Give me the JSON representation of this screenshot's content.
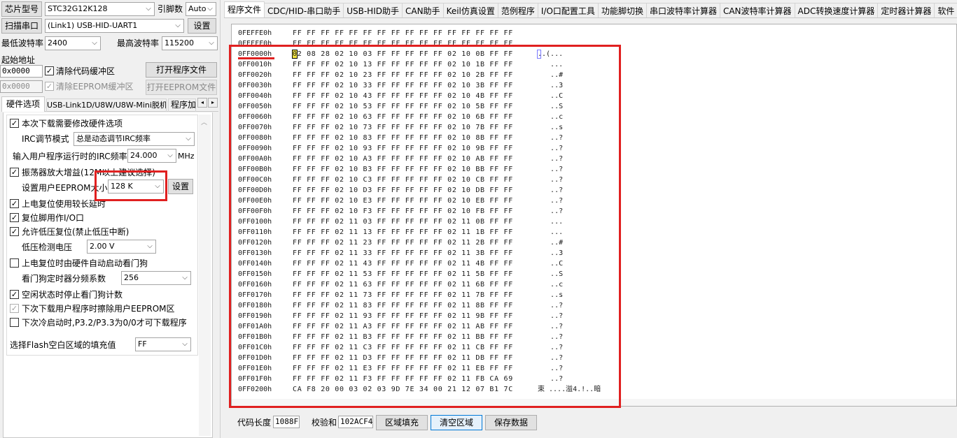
{
  "left": {
    "chip_label": "芯片型号",
    "chip_value": "STC32G12K128",
    "pins_label": "引脚数",
    "pins_value": "Auto",
    "scan_button": "扫描串口",
    "port_value": "(Link1) USB-HID-UART1",
    "settings_button": "设置",
    "min_baud_label": "最低波特率",
    "min_baud_value": "2400",
    "max_baud_label": "最高波特率",
    "max_baud_value": "115200",
    "start_addr_label": "起始地址",
    "code_addr_value": "0x0000",
    "clear_code_label": "清除代码缓冲区",
    "open_program_button": "打开程序文件",
    "eeprom_addr_value": "0x0000",
    "clear_eeprom_label": "清除EEPROM缓冲区",
    "open_eeprom_button": "打开EEPROM文件",
    "subtabs": [
      "硬件选项",
      "USB-Link1D/U8W/U8W-Mini脱机",
      "程序加"
    ],
    "options": {
      "opt1": "本次下载需要修改硬件选项",
      "irc_mode_label": "IRC调节模式",
      "irc_mode_value": "总是动态调节IRC频率",
      "irc_freq_label": "输入用户程序运行时的IRC频率",
      "irc_freq_value": "24.000",
      "irc_freq_unit": "MHz",
      "osc_gain_label": "振荡器放大增益(12M以上建议选择)",
      "eeprom_size_label": "设置用户EEPROM大小",
      "eeprom_size_value": "128  K",
      "eeprom_set_button": "设置",
      "long_delay_label": "上电复位使用较长延时",
      "reset_pin_label": "复位脚用作I/O口",
      "lvr_label": "允许低压复位(禁止低压中断)",
      "lv_detect_label": "低压检测电压",
      "lv_detect_value": "2.00 V",
      "wdt_label": "上电复位时由硬件自动启动看门狗",
      "wdt_div_label": "看门狗定时器分频系数",
      "wdt_div_value": "256",
      "idle_wdt_label": "空闲状态时停止看门狗计数",
      "erase_eeprom_label": "下次下载用户程序时擦除用户EEPROM区",
      "cold_boot_label": "下次冷启动时,P3.2/P3.3为0/0才可下载程序",
      "fill_label": "选择Flash空白区域的填充值",
      "fill_value": "FF"
    }
  },
  "tabs": [
    "程序文件",
    "CDC/HID-串口助手",
    "USB-HID助手",
    "CAN助手",
    "Keil仿真设置",
    "范例程序",
    "I/O口配置工具",
    "功能脚切换",
    "串口波特率计算器",
    "CAN波特率计算器",
    "ADC转换速度计算器",
    "定时器计算器",
    "软件"
  ],
  "hex_rows": [
    {
      "addr": "0FEFFE0h",
      "bytes": "FF FF FF FF FF FF FF FF FF FF FF FF FF FF FF FF",
      "ascii": ""
    },
    {
      "addr": "0FEFFF0h",
      "bytes": "FF FF FF FF FF FF FF FF FF FF FF FF FF FF FF FF",
      "ascii": ""
    },
    {
      "addr": "0FF0000h",
      "bytes": "02 08 28 02 10 03 FF FF FF FF FF 02 10 0B FF FF",
      "ascii": "..(..."
    },
    {
      "addr": "0FF0010h",
      "bytes": "FF FF FF 02 10 13 FF FF FF FF FF 02 10 1B FF FF",
      "ascii": "   ..."
    },
    {
      "addr": "0FF0020h",
      "bytes": "FF FF FF 02 10 23 FF FF FF FF FF 02 10 2B FF FF",
      "ascii": "   ..#"
    },
    {
      "addr": "0FF0030h",
      "bytes": "FF FF FF 02 10 33 FF FF FF FF FF 02 10 3B FF FF",
      "ascii": "   ..3"
    },
    {
      "addr": "0FF0040h",
      "bytes": "FF FF FF 02 10 43 FF FF FF FF FF 02 10 4B FF FF",
      "ascii": "   ..C"
    },
    {
      "addr": "0FF0050h",
      "bytes": "FF FF FF 02 10 53 FF FF FF FF FF 02 10 5B FF FF",
      "ascii": "   ..S"
    },
    {
      "addr": "0FF0060h",
      "bytes": "FF FF FF 02 10 63 FF FF FF FF FF 02 10 6B FF FF",
      "ascii": "   ..c"
    },
    {
      "addr": "0FF0070h",
      "bytes": "FF FF FF 02 10 73 FF FF FF FF FF 02 10 7B FF FF",
      "ascii": "   ..s"
    },
    {
      "addr": "0FF0080h",
      "bytes": "FF FF FF 02 10 83 FF FF FF FF FF 02 10 8B FF FF",
      "ascii": "   ..?"
    },
    {
      "addr": "0FF0090h",
      "bytes": "FF FF FF 02 10 93 FF FF FF FF FF 02 10 9B FF FF",
      "ascii": "   ..?"
    },
    {
      "addr": "0FF00A0h",
      "bytes": "FF FF FF 02 10 A3 FF FF FF FF FF 02 10 AB FF FF",
      "ascii": "   ..?"
    },
    {
      "addr": "0FF00B0h",
      "bytes": "FF FF FF 02 10 B3 FF FF FF FF FF 02 10 BB FF FF",
      "ascii": "   ..?"
    },
    {
      "addr": "0FF00C0h",
      "bytes": "FF FF FF 02 10 C3 FF FF FF FF FF 02 10 CB FF FF",
      "ascii": "   ..?"
    },
    {
      "addr": "0FF00D0h",
      "bytes": "FF FF FF 02 10 D3 FF FF FF FF FF 02 10 DB FF FF",
      "ascii": "   ..?"
    },
    {
      "addr": "0FF00E0h",
      "bytes": "FF FF FF 02 10 E3 FF FF FF FF FF 02 10 EB FF FF",
      "ascii": "   ..?"
    },
    {
      "addr": "0FF00F0h",
      "bytes": "FF FF FF 02 10 F3 FF FF FF FF FF 02 10 FB FF FF",
      "ascii": "   ..?"
    },
    {
      "addr": "0FF0100h",
      "bytes": "FF FF FF 02 11 03 FF FF FF FF FF 02 11 0B FF FF",
      "ascii": "   ..."
    },
    {
      "addr": "0FF0110h",
      "bytes": "FF FF FF 02 11 13 FF FF FF FF FF 02 11 1B FF FF",
      "ascii": "   ..."
    },
    {
      "addr": "0FF0120h",
      "bytes": "FF FF FF 02 11 23 FF FF FF FF FF 02 11 2B FF FF",
      "ascii": "   ..#"
    },
    {
      "addr": "0FF0130h",
      "bytes": "FF FF FF 02 11 33 FF FF FF FF FF 02 11 3B FF FF",
      "ascii": "   ..3"
    },
    {
      "addr": "0FF0140h",
      "bytes": "FF FF FF 02 11 43 FF FF FF FF FF 02 11 4B FF FF",
      "ascii": "   ..C"
    },
    {
      "addr": "0FF0150h",
      "bytes": "FF FF FF 02 11 53 FF FF FF FF FF 02 11 5B FF FF",
      "ascii": "   ..S"
    },
    {
      "addr": "0FF0160h",
      "bytes": "FF FF FF 02 11 63 FF FF FF FF FF 02 11 6B FF FF",
      "ascii": "   ..c"
    },
    {
      "addr": "0FF0170h",
      "bytes": "FF FF FF 02 11 73 FF FF FF FF FF 02 11 7B FF FF",
      "ascii": "   ..s"
    },
    {
      "addr": "0FF0180h",
      "bytes": "FF FF FF 02 11 83 FF FF FF FF FF 02 11 8B FF FF",
      "ascii": "   ..?"
    },
    {
      "addr": "0FF0190h",
      "bytes": "FF FF FF 02 11 93 FF FF FF FF FF 02 11 9B FF FF",
      "ascii": "   ..?"
    },
    {
      "addr": "0FF01A0h",
      "bytes": "FF FF FF 02 11 A3 FF FF FF FF FF 02 11 AB FF FF",
      "ascii": "   ..?"
    },
    {
      "addr": "0FF01B0h",
      "bytes": "FF FF FF 02 11 B3 FF FF FF FF FF 02 11 BB FF FF",
      "ascii": "   ..?"
    },
    {
      "addr": "0FF01C0h",
      "bytes": "FF FF FF 02 11 C3 FF FF FF FF FF 02 11 CB FF FF",
      "ascii": "   ..?"
    },
    {
      "addr": "0FF01D0h",
      "bytes": "FF FF FF 02 11 D3 FF FF FF FF FF 02 11 DB FF FF",
      "ascii": "   ..?"
    },
    {
      "addr": "0FF01E0h",
      "bytes": "FF FF FF 02 11 E3 FF FF FF FF FF 02 11 EB FF FF",
      "ascii": "   ..?"
    },
    {
      "addr": "0FF01F0h",
      "bytes": "FF FF FF 02 11 F3 FF FF FF FF FF 02 11 FB CA 69",
      "ascii": "   ..?"
    },
    {
      "addr": "0FF0200h",
      "bytes": "CA F8 20 00 03 02 03 9D 7E 34 00 21 12 07 B1 7C",
      "ascii": "束 ....溢4.!..暗"
    }
  ],
  "bottom": {
    "code_len_label": "代码长度",
    "code_len_value": "1088F",
    "checksum_label": "校验和",
    "checksum_value": "102ACF4",
    "fill_area_button": "区域填充",
    "clear_area_button": "清空区域",
    "save_data_button": "保存数据"
  },
  "colors": {
    "highlight": "#e02020",
    "selection": "#f5e642",
    "focus": "#0078d7"
  }
}
